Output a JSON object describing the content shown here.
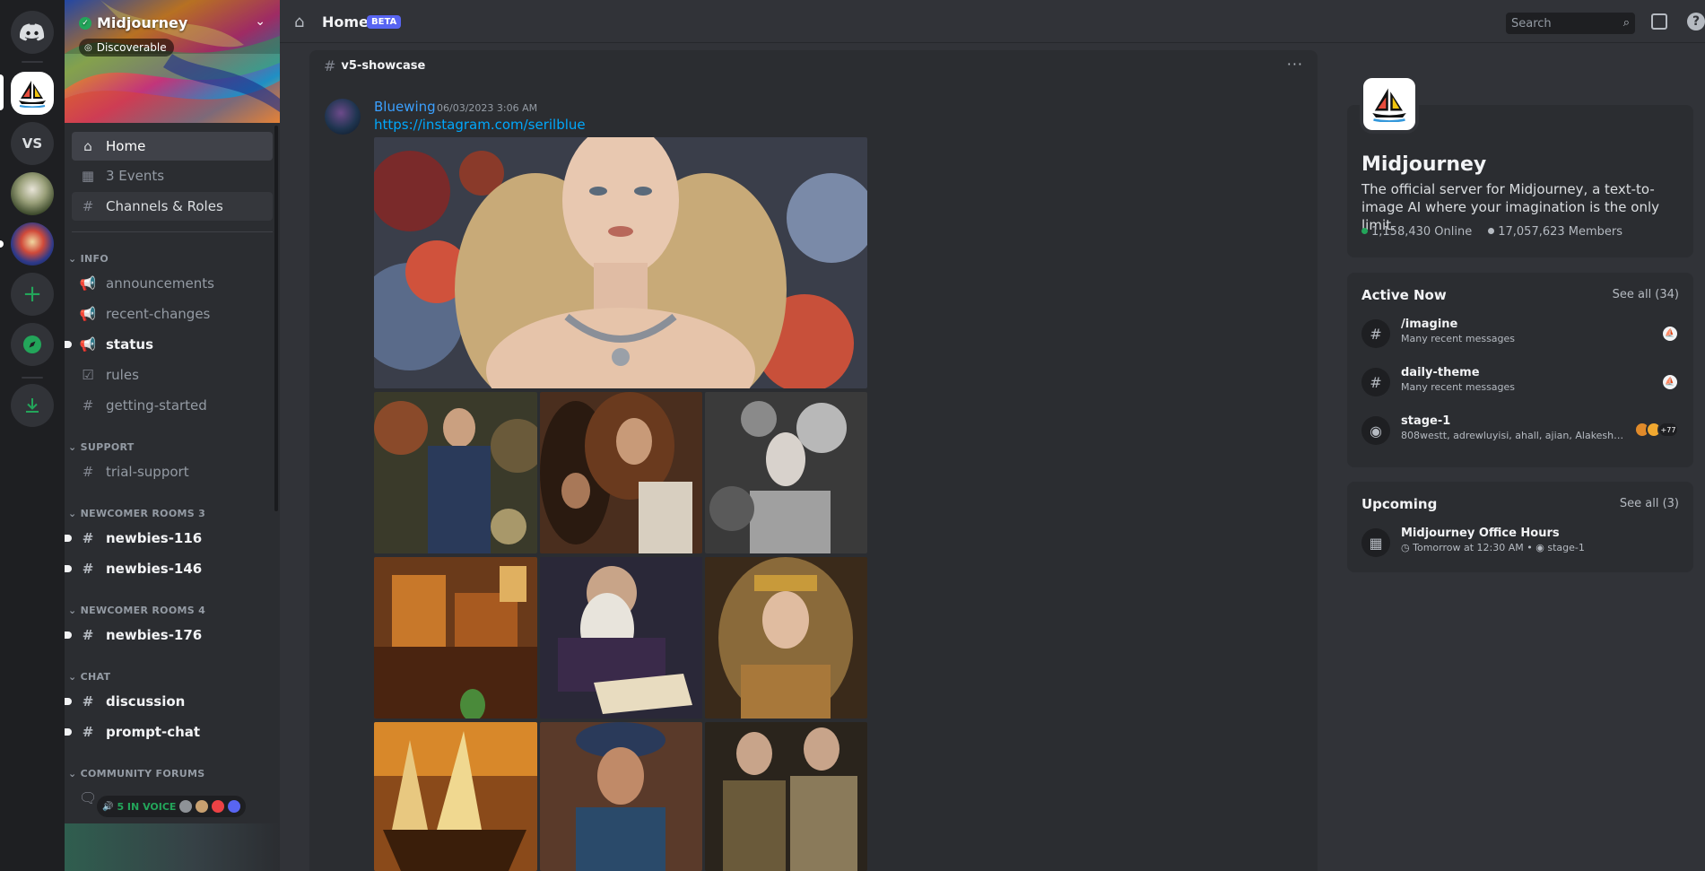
{
  "rail": {
    "servers": [
      {
        "label": ""
      },
      {
        "label": "VS"
      }
    ]
  },
  "server": {
    "name": "Midjourney",
    "discoverable_label": "Discoverable",
    "description": "The official server for Midjourney, a text-to-image AI where your imagination is the only limit.",
    "online": "1,158,430 Online",
    "members": "17,057,623 Members"
  },
  "sidebar": {
    "top_items": [
      {
        "label": "Home"
      },
      {
        "label": "3 Events"
      },
      {
        "label": "Channels & Roles"
      }
    ],
    "categories": [
      {
        "name": "INFO",
        "channels": [
          "announcements",
          "recent-changes",
          "status",
          "rules",
          "getting-started"
        ]
      },
      {
        "name": "SUPPORT",
        "channels": [
          "trial-support"
        ]
      },
      {
        "name": "NEWCOMER ROOMS 3",
        "channels": [
          "newbies-116",
          "newbies-146"
        ]
      },
      {
        "name": "NEWCOMER ROOMS 4",
        "channels": [
          "newbies-176"
        ]
      },
      {
        "name": "CHAT",
        "channels": [
          "discussion",
          "prompt-chat"
        ]
      },
      {
        "name": "COMMUNITY FORUMS",
        "channels": []
      }
    ],
    "voice_label": "5 IN VOICE"
  },
  "header": {
    "title": "Home",
    "badge": "BETA",
    "search_placeholder": "Search"
  },
  "feed": {
    "channel": "v5-showcase",
    "message": {
      "author": "Bluewing",
      "timestamp": "06/03/2023 3:06 AM",
      "link": "https://instagram.com/serilblue"
    }
  },
  "right": {
    "active_now": {
      "title": "Active Now",
      "see_all": "See all (34)",
      "items": [
        {
          "name": "/imagine",
          "sub": "Many recent messages"
        },
        {
          "name": "daily-theme",
          "sub": "Many recent messages"
        },
        {
          "name": "stage-1",
          "sub": "808westt, adrewluyisi, ahall, ajian, Alakesh1000,...",
          "extra": "+77"
        }
      ]
    },
    "upcoming": {
      "title": "Upcoming",
      "see_all": "See all (3)",
      "event_name": "Midjourney Office Hours",
      "event_time": "Tomorrow at 12:30 AM",
      "event_stage": "stage-1"
    }
  },
  "colors": {
    "accent": "#5865f2",
    "online": "#23a55a",
    "link": "#00a8fc",
    "author": "#3ba0ff"
  }
}
